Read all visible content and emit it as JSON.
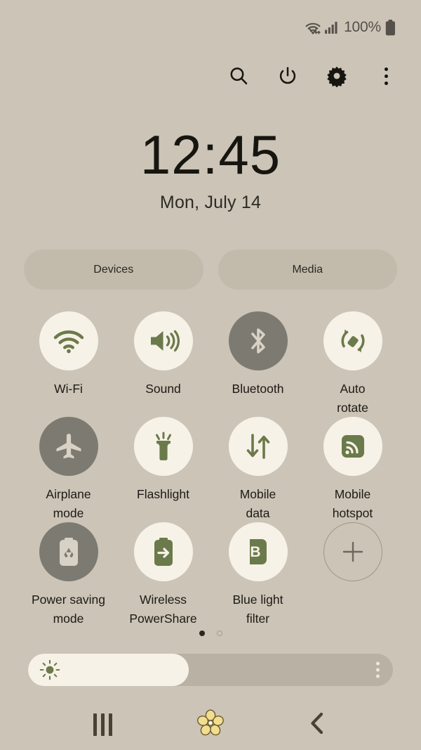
{
  "status_bar": {
    "wifi_icon": "wifi-signal-icon",
    "cellular_icon": "cellular-bars-icon",
    "battery_percent": "100%",
    "battery_icon": "battery-full-icon"
  },
  "header": {
    "buttons": [
      {
        "name": "search-icon",
        "label": "Search"
      },
      {
        "name": "power-icon",
        "label": "Power"
      },
      {
        "name": "gear-icon",
        "label": "Settings"
      },
      {
        "name": "overflow-menu-icon",
        "label": "More options"
      }
    ]
  },
  "clock": {
    "time": "12:45",
    "date": "Mon, July 14"
  },
  "pills": [
    {
      "label": "Devices"
    },
    {
      "label": "Media"
    }
  ],
  "toggles": [
    {
      "label": "Wi-Fi",
      "icon": "wifi-icon",
      "state": "on"
    },
    {
      "label": "Sound",
      "icon": "sound-icon",
      "state": "on"
    },
    {
      "label": "Bluetooth",
      "icon": "bluetooth-icon",
      "state": "off"
    },
    {
      "label": "Auto\nrotate",
      "icon": "auto-rotate-icon",
      "state": "on"
    },
    {
      "label": "Airplane\nmode",
      "icon": "airplane-icon",
      "state": "off"
    },
    {
      "label": "Flashlight",
      "icon": "flashlight-icon",
      "state": "on"
    },
    {
      "label": "Mobile\ndata",
      "icon": "mobile-data-icon",
      "state": "on"
    },
    {
      "label": "Mobile\nhotspot",
      "icon": "mobile-hotspot-icon",
      "state": "on"
    },
    {
      "label": "Power saving\nmode",
      "icon": "power-saving-icon",
      "state": "off"
    },
    {
      "label": "Wireless\nPowerShare",
      "icon": "wireless-powershare-icon",
      "state": "on"
    },
    {
      "label": "Blue light\nfilter",
      "icon": "blue-light-filter-icon",
      "state": "on"
    },
    {
      "label": "",
      "icon": "add-tile-icon",
      "state": "add"
    }
  ],
  "page_dots": {
    "count": 2,
    "active_index": 0
  },
  "brightness": {
    "percent": 44,
    "sun_icon": "brightness-sun-icon",
    "menu_icon": "brightness-options-icon"
  },
  "nav_bar": [
    {
      "name": "recents-button",
      "icon": "recents-icon"
    },
    {
      "name": "home-button",
      "icon": "flower-home-icon"
    },
    {
      "name": "back-button",
      "icon": "back-chevron-icon"
    }
  ],
  "colors": {
    "background": "#cbc4b7",
    "tile_on": "#f7f2e8",
    "tile_off": "#7d7a72",
    "accent_green": "#6b7a4a",
    "text": "#17150f",
    "pill": "#c2bbac",
    "home_flower": "#f2de8e"
  }
}
